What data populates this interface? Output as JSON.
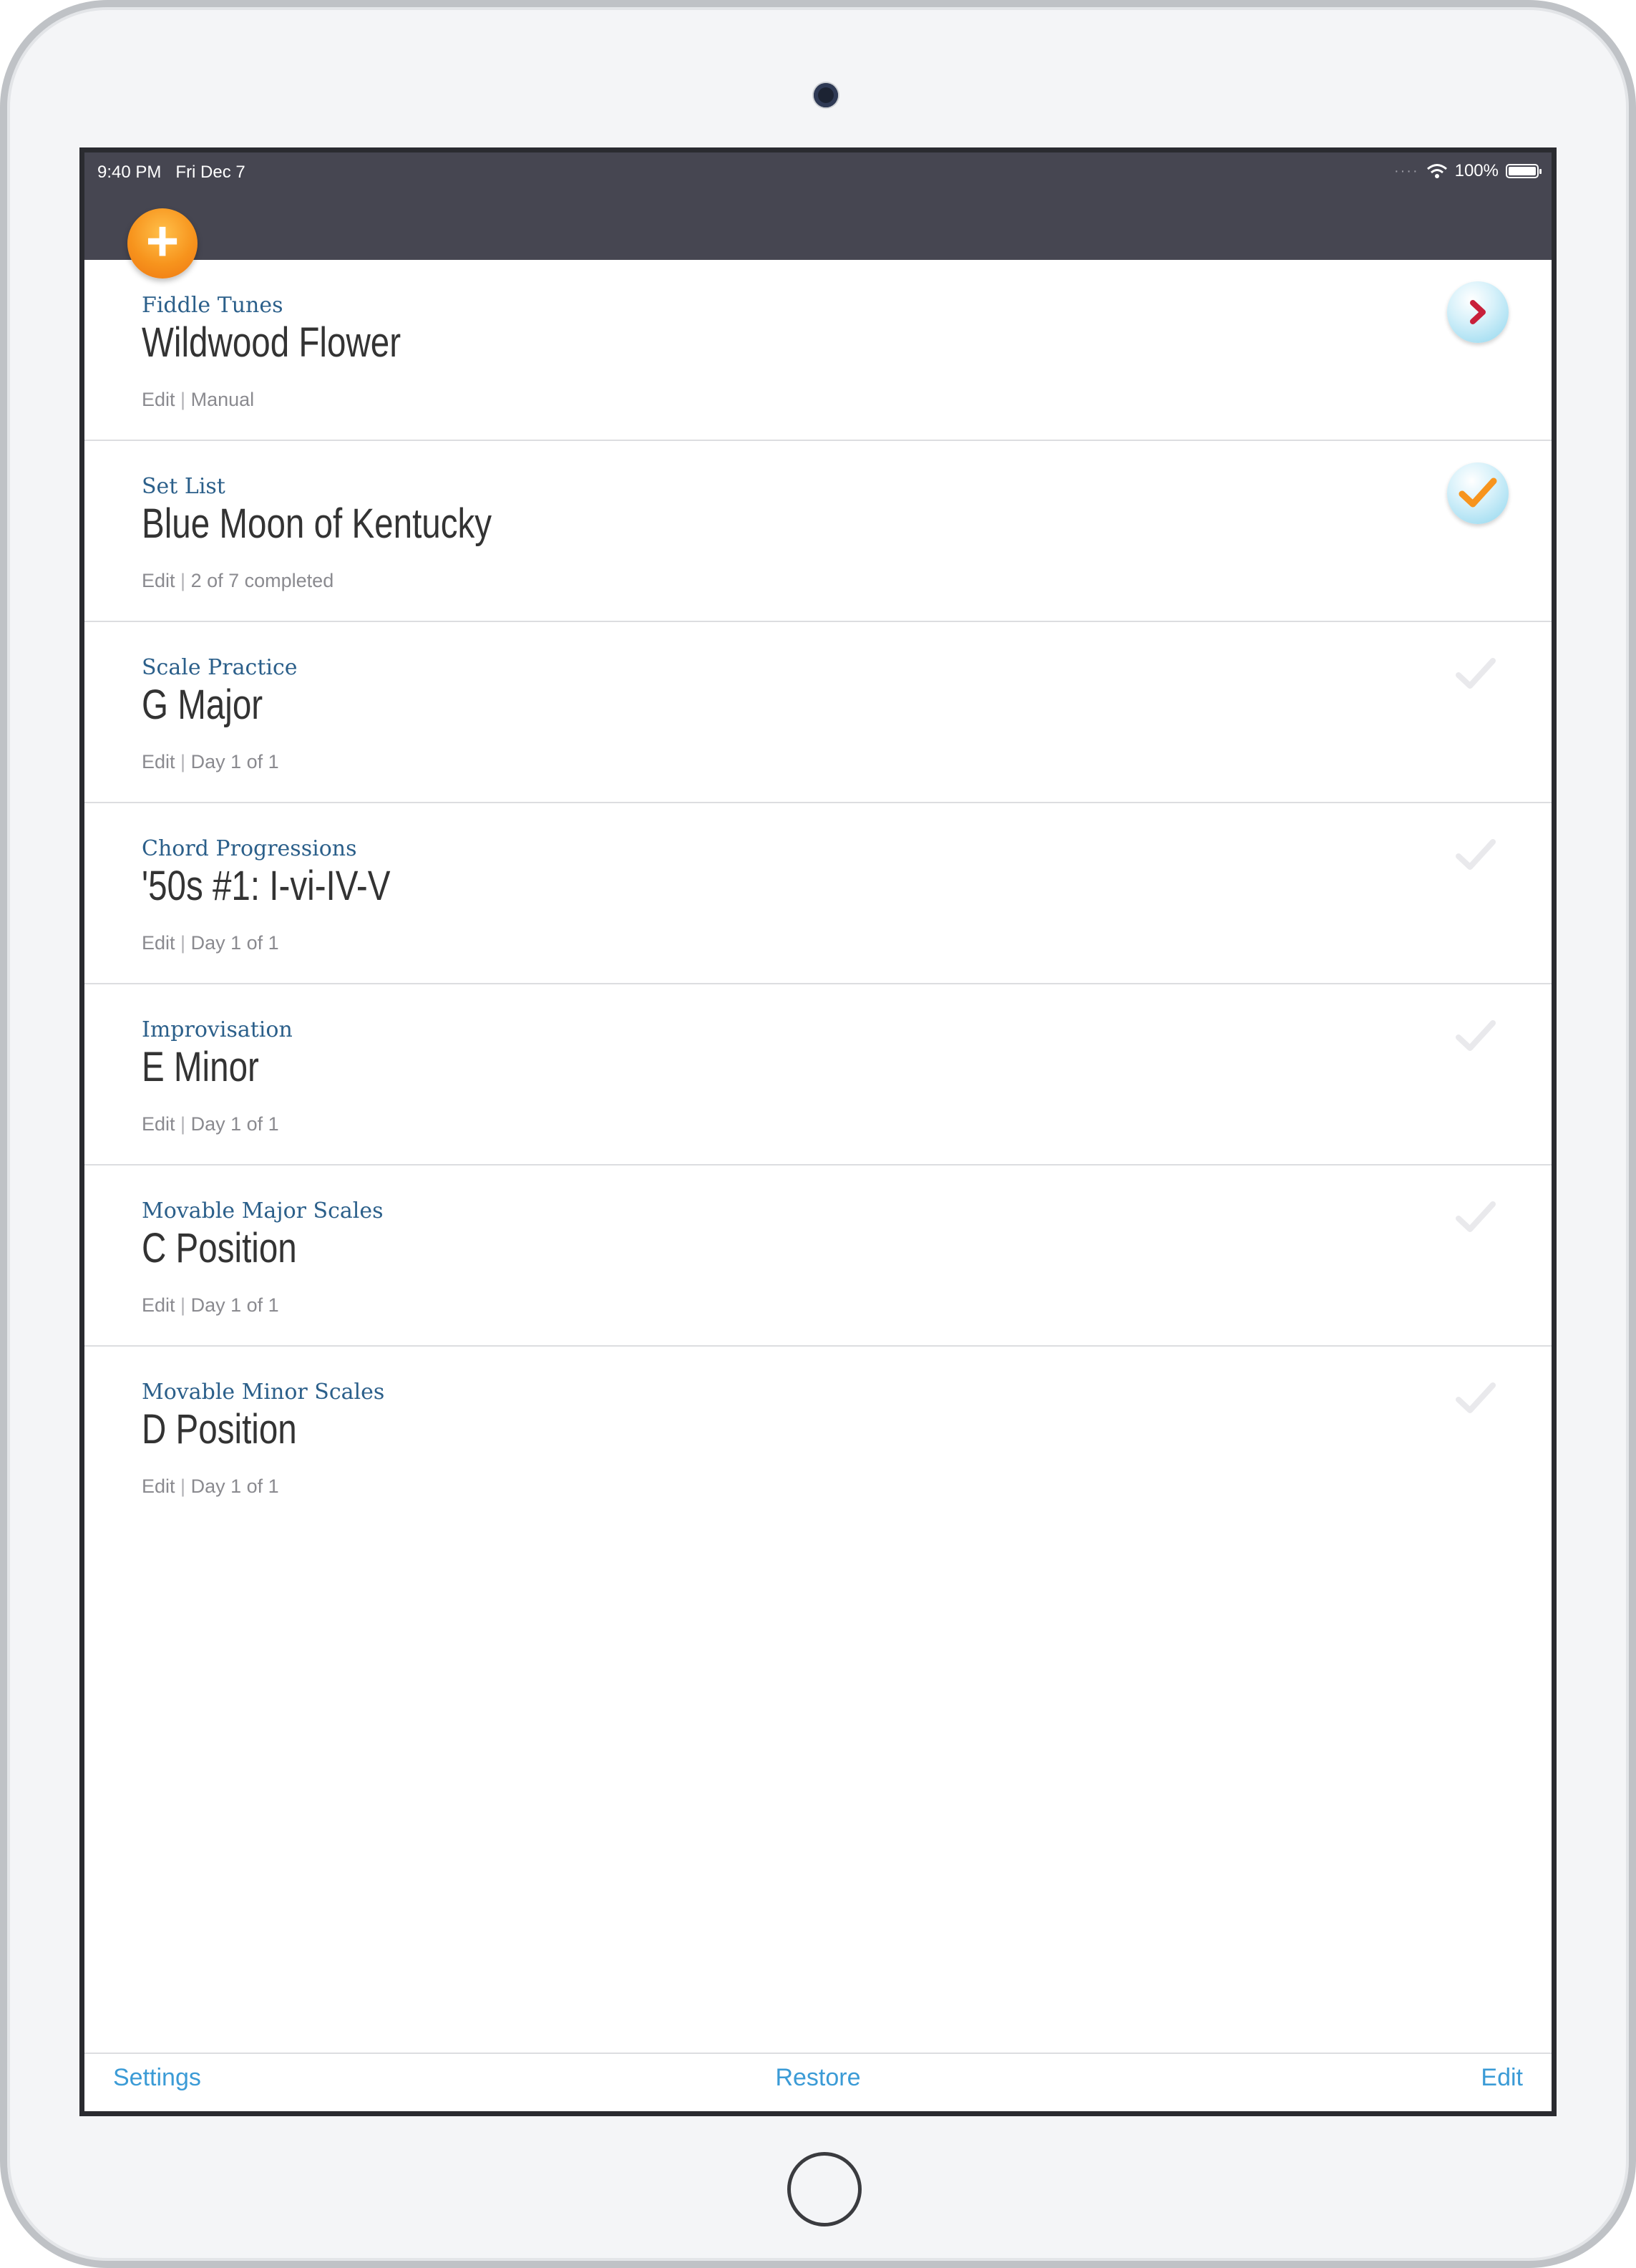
{
  "status_bar": {
    "time": "9:40 PM",
    "date": "Fri Dec 7",
    "battery": "100%"
  },
  "colors": {
    "accent_orange": "#f7941d",
    "link_blue": "#3b9bd6",
    "category_blue": "#2b5f8a",
    "topbar": "#464651"
  },
  "items": [
    {
      "category": "Fiddle Tunes",
      "title": "Wildwood Flower",
      "edit": "Edit",
      "detail": "Manual",
      "action": "chevron-right-icon"
    },
    {
      "category": "Set List",
      "title": "Blue Moon of Kentucky",
      "edit": "Edit",
      "detail": "2 of 7 completed",
      "action": "check-icon"
    },
    {
      "category": "Scale Practice",
      "title": "G Major",
      "edit": "Edit",
      "detail": "Day 1 of 1",
      "action": "check-faint-icon"
    },
    {
      "category": "Chord Progressions",
      "title": "'50s #1:  I-vi-IV-V",
      "edit": "Edit",
      "detail": "Day 1 of 1",
      "action": "check-faint-icon"
    },
    {
      "category": "Improvisation",
      "title": "E Minor",
      "edit": "Edit",
      "detail": "Day 1 of 1",
      "action": "check-faint-icon"
    },
    {
      "category": "Movable Major Scales",
      "title": "C Position",
      "edit": "Edit",
      "detail": "Day 1 of 1",
      "action": "check-faint-icon"
    },
    {
      "category": "Movable Minor Scales",
      "title": "D Position",
      "edit": "Edit",
      "detail": "Day 1 of 1",
      "action": "check-faint-icon"
    }
  ],
  "toolbar": {
    "settings": "Settings",
    "restore": "Restore",
    "edit": "Edit"
  }
}
